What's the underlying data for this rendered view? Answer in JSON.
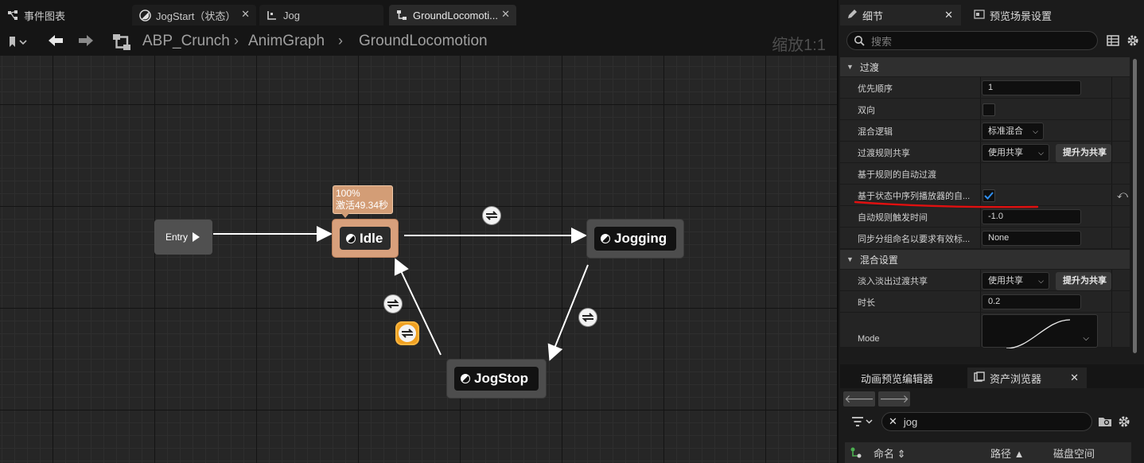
{
  "tabs": [
    {
      "label": "事件图表",
      "icon": "event-graph-icon"
    },
    {
      "label": "JogStart（状态）",
      "icon": "state-icon"
    },
    {
      "label": "Jog",
      "icon": "blendspace-icon"
    },
    {
      "label": "GroundLocomoti...",
      "icon": "state-machine-icon",
      "active": true
    }
  ],
  "breadcrumb": [
    "ABP_Crunch",
    "AnimGraph",
    "GroundLocomotion"
  ],
  "zoom_label": "缩放1:1",
  "graph": {
    "entry_label": "Entry",
    "states": [
      {
        "id": "idle",
        "label": "Idle",
        "active": true
      },
      {
        "id": "jogging",
        "label": "Jogging"
      },
      {
        "id": "jogstop",
        "label": "JogStop"
      }
    ],
    "idle_bubble": {
      "percent": "100%",
      "active_time": "激活49.34秒"
    }
  },
  "details": {
    "tab_label": "细节",
    "tab2_label": "预览场景设置",
    "search_placeholder": "搜索",
    "sections": [
      {
        "title": "过渡",
        "rows": [
          {
            "name": "优先顺序",
            "type": "number",
            "value": "1"
          },
          {
            "name": "双向",
            "type": "checkbox",
            "checked": false
          },
          {
            "name": "混合逻辑",
            "type": "combo",
            "value": "标准混合"
          },
          {
            "name": "过渡规则共享",
            "type": "combo",
            "value": "使用共享",
            "button": "提升为共享"
          },
          {
            "name": "基于规则的自动过渡",
            "type": "label"
          },
          {
            "name": "基于状态中序列播放器的自...",
            "type": "checkbox",
            "checked": true,
            "reset": true
          },
          {
            "name": "自动规则触发时间",
            "type": "number",
            "value": "-1.0"
          },
          {
            "name": "同步分组命名以要求有效标...",
            "type": "text",
            "value": "None"
          }
        ]
      },
      {
        "title": "混合设置",
        "rows": [
          {
            "name": "淡入淡出过渡共享",
            "type": "combo",
            "value": "使用共享",
            "button": "提升为共享"
          },
          {
            "name": "时长",
            "type": "number",
            "value": "0.2"
          },
          {
            "name": "Mode",
            "type": "curve"
          }
        ]
      }
    ]
  },
  "content_browser": {
    "tabs": [
      "动画预览编辑器",
      "资产浏览器"
    ],
    "search_value": "jog",
    "columns": [
      "命名",
      "路径",
      "磁盘空间"
    ]
  },
  "colors": {
    "accent": "#0070e0",
    "idle_node": "#d8a07c",
    "annotation": "#e01010",
    "selected_transition": "#f0a020"
  }
}
